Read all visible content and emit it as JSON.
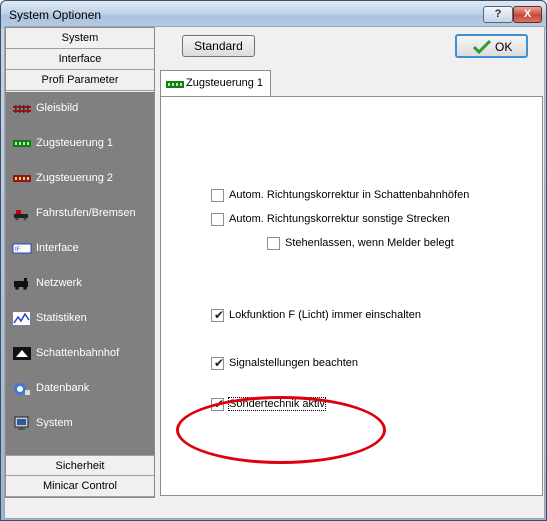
{
  "window": {
    "title": "System Optionen",
    "help_label": "?",
    "close_label": "X"
  },
  "nav": {
    "headers_top": [
      "System",
      "Interface",
      "Profi Parameter"
    ],
    "items": [
      {
        "label": "Gleisbild",
        "icon": "track-icon"
      },
      {
        "label": "Zugsteuerung 1",
        "icon": "train-control-icon"
      },
      {
        "label": "Zugsteuerung 2",
        "icon": "train-control-2-icon"
      },
      {
        "label": "Fahrstufen/Bremsen",
        "icon": "speed-steps-icon"
      },
      {
        "label": "Interface",
        "icon": "interface-icon"
      },
      {
        "label": "Netzwerk",
        "icon": "network-icon"
      },
      {
        "label": "Statistiken",
        "icon": "statistics-icon"
      },
      {
        "label": "Schattenbahnhof",
        "icon": "shadow-station-icon"
      },
      {
        "label": "Datenbank",
        "icon": "database-icon"
      },
      {
        "label": "System",
        "icon": "computer-icon"
      }
    ],
    "headers_bottom": [
      "Sicherheit",
      "Minicar Control"
    ]
  },
  "buttons": {
    "standard": "Standard",
    "ok": "OK"
  },
  "tab": {
    "label": "Zugsteuerung 1"
  },
  "options": [
    {
      "label": "Autom. Richtungskorrektur in Schattenbahnhöfen",
      "checked": false
    },
    {
      "label": "Autom. Richtungskorrektur sonstige Strecken",
      "checked": false
    },
    {
      "label": "Stehenlassen, wenn Melder belegt",
      "checked": false
    },
    {
      "label": "Lokfunktion F (Licht) immer einschalten",
      "checked": true
    },
    {
      "label": "Signalstellungen beachten",
      "checked": true
    },
    {
      "label": "Sondertechnik aktiv",
      "checked": true
    }
  ],
  "colors": {
    "nav_background": "#808080",
    "highlight_ellipse": "#e0000d",
    "ok_check": "#2e9b2e"
  }
}
